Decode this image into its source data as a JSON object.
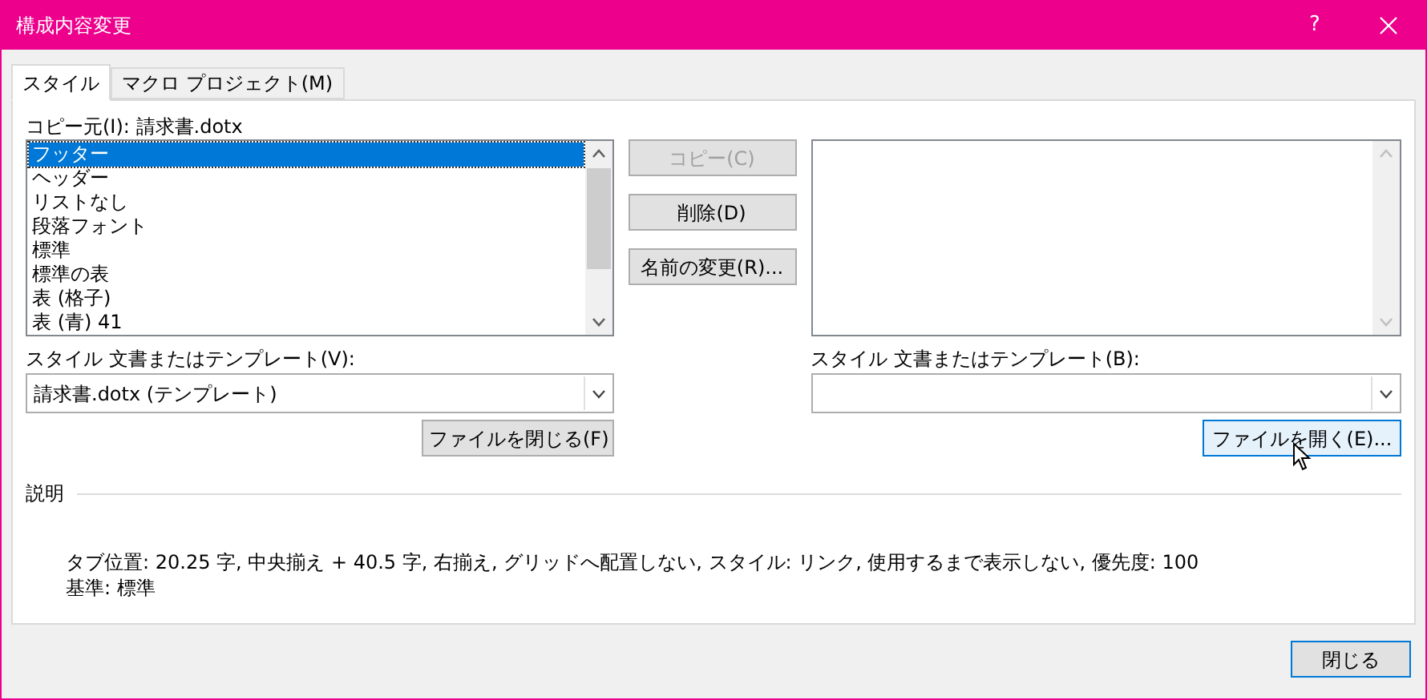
{
  "window": {
    "title": "構成内容変更",
    "help": "?"
  },
  "tabs": [
    {
      "label": "スタイル",
      "selected": true
    },
    {
      "label": "マクロ プロジェクト(M)",
      "selected": false
    }
  ],
  "left": {
    "label": "コピー元(I): 請求書.dotx",
    "items": [
      {
        "label": "フッター",
        "selected": true
      },
      {
        "label": "ヘッダー",
        "selected": false
      },
      {
        "label": "リストなし",
        "selected": false
      },
      {
        "label": "段落フォント",
        "selected": false
      },
      {
        "label": "標準",
        "selected": false
      },
      {
        "label": "標準の表",
        "selected": false
      },
      {
        "label": "表 (格子)",
        "selected": false
      },
      {
        "label": "表 (青)  41",
        "selected": false
      }
    ],
    "scroll_disabled": false,
    "combo_label": "スタイル 文書またはテンプレート(V):",
    "combo_value": "請求書.dotx (テンプレート)",
    "file_button": {
      "label": "ファイルを閉じる(F)",
      "hovered": false
    }
  },
  "middle_buttons": [
    {
      "label": "コピー(C)",
      "disabled": true
    },
    {
      "label": "削除(D)",
      "disabled": false
    },
    {
      "label": "名前の変更(R)...",
      "disabled": false
    }
  ],
  "right": {
    "scroll_disabled": true,
    "combo_label": "スタイル 文書またはテンプレート(B):",
    "file_button": {
      "label": "ファイルを開く(E)...",
      "hovered": true
    }
  },
  "description": {
    "heading": "説明",
    "lines": [
      "タブ位置:  20.25 字, 中央揃え +  40.5 字, 右揃え, グリッドへ配置しない, スタイル: リンク, 使用するまで表示しない, 優先度: 100",
      "基準: 標準"
    ]
  },
  "close_button": "閉じる"
}
